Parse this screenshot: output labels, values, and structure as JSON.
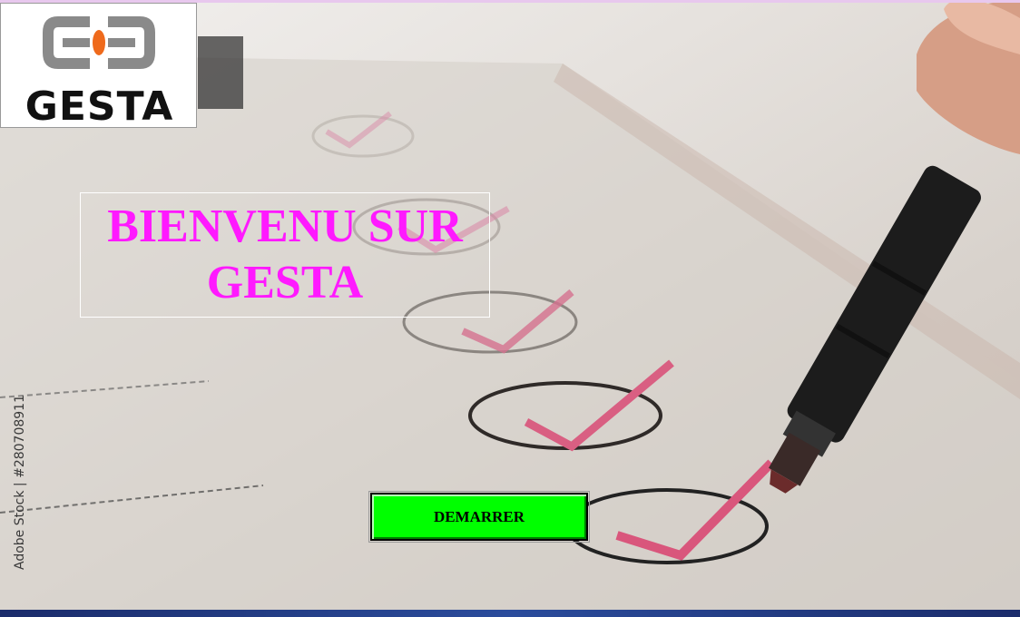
{
  "logo": {
    "text": "GESTA",
    "icon": "gesta-logo-icon",
    "colors": {
      "gray": "#8a8a8a",
      "accent": "#ef6a1c",
      "text": "#111111"
    }
  },
  "welcome": {
    "line1": "BIENVENU SUR",
    "line2": "GESTA",
    "color": "#ff19ff"
  },
  "start_button": {
    "label": "DEMARRER",
    "color": "#00ff00"
  },
  "watermark": {
    "side_text": "Adobe Stock | #280708911"
  }
}
